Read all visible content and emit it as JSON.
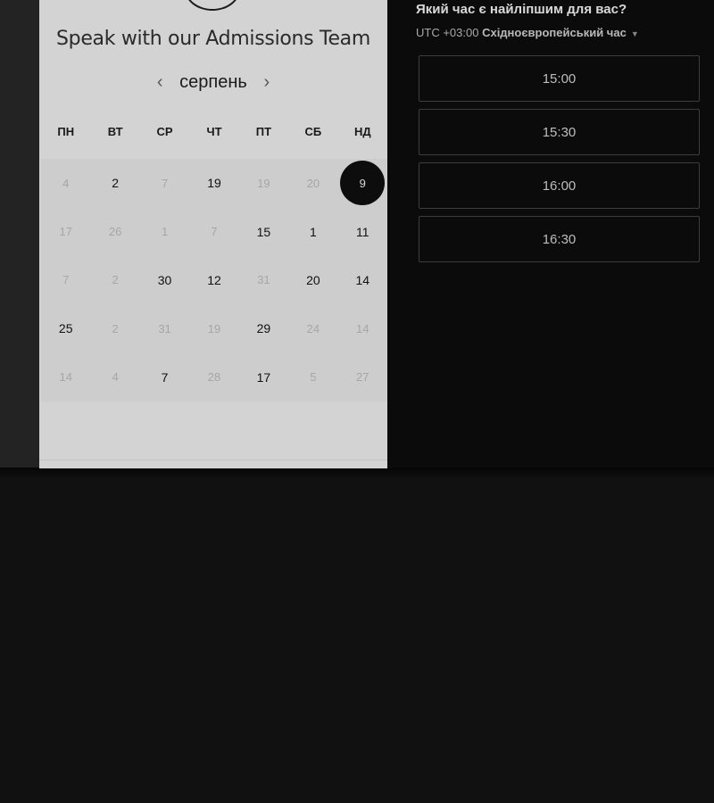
{
  "panel": {
    "title": "Speak with our Admissions Team",
    "month": "серпень",
    "prev_icon": "chevron-left-icon",
    "next_icon": "chevron-right-icon",
    "weekdays": [
      "ПН",
      "ВТ",
      "СР",
      "ЧТ",
      "ПТ",
      "СБ",
      "НД"
    ],
    "weeks": [
      [
        {
          "d": "4",
          "s": "muted"
        },
        {
          "d": "2",
          "s": "avail"
        },
        {
          "d": "7",
          "s": "muted"
        },
        {
          "d": "19",
          "s": "avail"
        },
        {
          "d": "19",
          "s": "muted"
        },
        {
          "d": "20",
          "s": "muted"
        },
        {
          "d": "9",
          "s": "selected"
        }
      ],
      [
        {
          "d": "17",
          "s": "muted"
        },
        {
          "d": "26",
          "s": "muted"
        },
        {
          "d": "1",
          "s": "muted"
        },
        {
          "d": "7",
          "s": "muted"
        },
        {
          "d": "15",
          "s": "avail"
        },
        {
          "d": "1",
          "s": "avail"
        },
        {
          "d": "11",
          "s": "avail"
        }
      ],
      [
        {
          "d": "7",
          "s": "muted"
        },
        {
          "d": "2",
          "s": "muted"
        },
        {
          "d": "30",
          "s": "avail"
        },
        {
          "d": "12",
          "s": "avail"
        },
        {
          "d": "31",
          "s": "muted"
        },
        {
          "d": "20",
          "s": "avail"
        },
        {
          "d": "14",
          "s": "avail"
        }
      ],
      [
        {
          "d": "25",
          "s": "avail"
        },
        {
          "d": "2",
          "s": "muted"
        },
        {
          "d": "31",
          "s": "muted"
        },
        {
          "d": "19",
          "s": "muted"
        },
        {
          "d": "29",
          "s": "avail"
        },
        {
          "d": "24",
          "s": "muted"
        },
        {
          "d": "14",
          "s": "muted"
        }
      ],
      [
        {
          "d": "14",
          "s": "muted"
        },
        {
          "d": "4",
          "s": "muted"
        },
        {
          "d": "7",
          "s": "avail"
        },
        {
          "d": "28",
          "s": "muted"
        },
        {
          "d": "17",
          "s": "avail"
        },
        {
          "d": "5",
          "s": "muted"
        },
        {
          "d": "27",
          "s": "muted"
        }
      ]
    ]
  },
  "times": {
    "heading": "Який час є найліпшим для вас?",
    "tz_offset": "UTC +03:00",
    "tz_name": "Східноєвропейський час",
    "tz_icon": "caret-down-icon",
    "slots": [
      "15:00",
      "15:30",
      "16:00",
      "16:30"
    ]
  }
}
